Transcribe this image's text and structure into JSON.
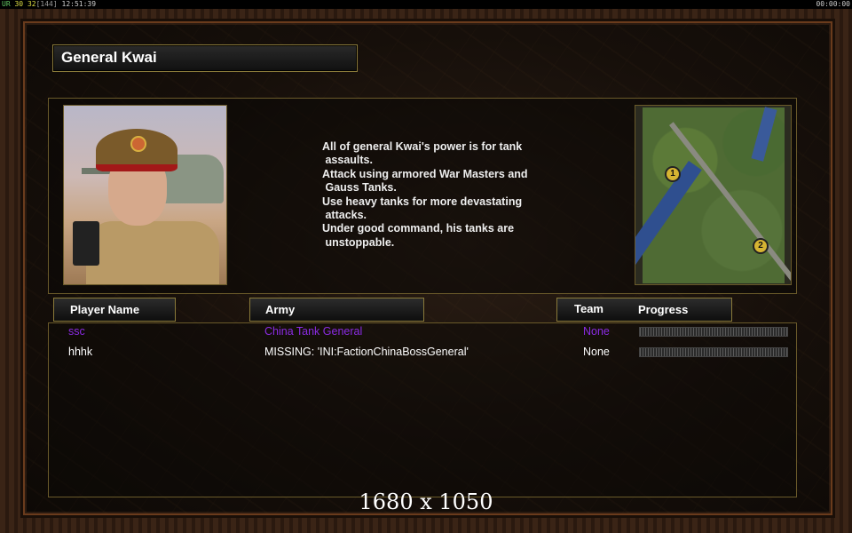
{
  "status_bar": {
    "fps_label": "UR",
    "fps_value": "30",
    "fps_target": "32",
    "fps_extra": "[144]",
    "clock": "12:51:39",
    "timer": "00:00:00"
  },
  "general": {
    "name": "General Kwai",
    "description_lines": [
      "All of general Kwai's power is for tank",
      " assaults.",
      "Attack using armored War Masters and",
      " Gauss Tanks.",
      "Use heavy tanks for more devastating",
      " attacks.",
      "Under good command, his tanks are",
      " unstoppable."
    ]
  },
  "minimap": {
    "start_positions": [
      "1",
      "2"
    ]
  },
  "table": {
    "headers": {
      "player_name": "Player Name",
      "army": "Army",
      "team": "Team",
      "progress": "Progress"
    },
    "rows": [
      {
        "name": "ssc",
        "army": "China Tank General",
        "team": "None",
        "color": "#8a2be2"
      },
      {
        "name": "hhhk",
        "army": "MISSING: 'INI:FactionChinaBossGeneral'",
        "team": "None",
        "color": "#ffffff"
      }
    ]
  },
  "resolution_label": "1680 x 1050"
}
